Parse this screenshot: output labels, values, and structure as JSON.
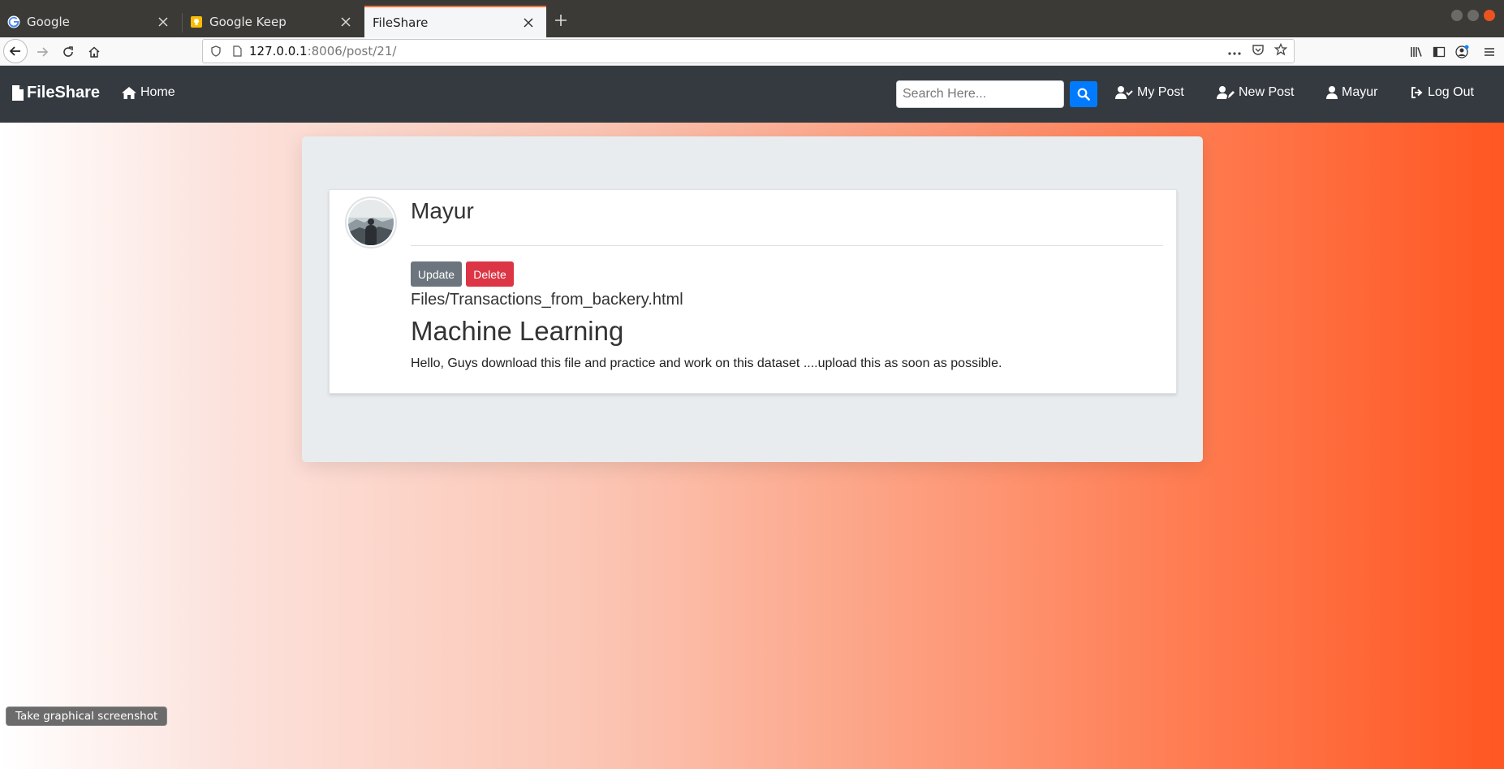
{
  "browser": {
    "tabs": [
      {
        "label": "Google"
      },
      {
        "label": "Google Keep"
      },
      {
        "label": "FileShare"
      }
    ],
    "url_host": "127.0.0.1",
    "url_rest": ":8006/post/21/",
    "accent": "#ff7139"
  },
  "nav": {
    "brand": "FileShare",
    "home": "Home",
    "search_placeholder": "Search Here...",
    "my_post": "My Post",
    "new_post": "New Post",
    "user": "Mayur",
    "logout": "Log Out",
    "colors": {
      "navbar": "#343a40",
      "search_button": "#007bff"
    }
  },
  "post": {
    "author": "Mayur",
    "update_label": "Update",
    "delete_label": "Delete",
    "file": "Files/Transactions_from_backery.html",
    "title": "Machine Learning",
    "body": "Hello, Guys download this file and practice and work on this dataset ....upload this as soon as possible.",
    "colors": {
      "update": "#6c757d",
      "delete": "#dc3545"
    }
  },
  "tooltip": "Take graphical screenshot"
}
